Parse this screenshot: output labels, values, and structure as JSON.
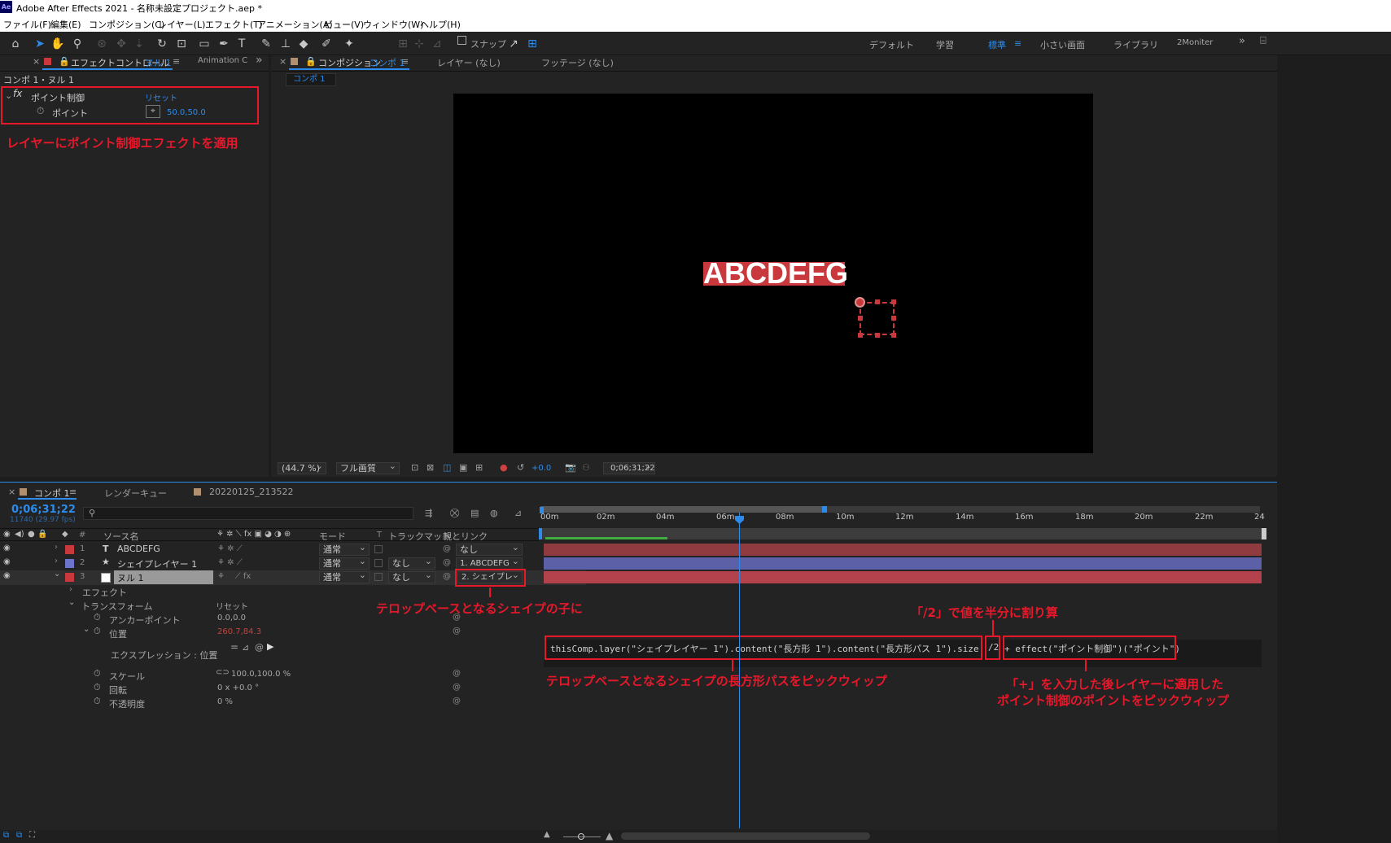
{
  "window": {
    "title": "Adobe After Effects 2021 - 名称未設定プロジェクト.aep *",
    "logo": "Ae"
  },
  "menu": [
    "ファイル(F)",
    "編集(E)",
    "コンポジション(C)",
    "レイヤー(L)",
    "エフェクト(T)",
    "アニメーション(A)",
    "ビュー(V)",
    "ウィンドウ(W)",
    "ヘルプ(H)"
  ],
  "toolbar": {
    "snap_label": "スナップ",
    "workspaces": [
      "デフォルト",
      "学習",
      "標準",
      "小さい画面",
      "ライブラリ",
      "2Moniter"
    ],
    "active_workspace": "標準"
  },
  "effect_panel": {
    "tab_label": "エフェクトコントロール",
    "tab_layer": "ヌル 1",
    "tab2": "Animation C",
    "breadcrumb": "コンポ 1・ヌル 1",
    "effect_name": "ポイント制御",
    "reset": "リセット",
    "param_name": "ポイント",
    "param_value": "50.0,50.0",
    "annotation": "レイヤーにポイント制御エフェクトを適用"
  },
  "comp_panel": {
    "tab_label": "コンポジション",
    "tab_comp": "コンポ 1",
    "layer_tab": "レイヤー (なし)",
    "footage_tab": "フッテージ (なし)",
    "comp_chip": "コンポ 1",
    "viewer_text": "ABCDEFG",
    "zoom": "(44.7 %)",
    "quality": "フル画質",
    "exposure": "+0.0",
    "timecode": "0;06;31;22"
  },
  "timeline": {
    "tabs": [
      "コンポ 1",
      "レンダーキュー",
      "20220125_213522"
    ],
    "timecode": "0;06;31;22",
    "fps": "11740 (29.97 fps)",
    "headers": {
      "num": "#",
      "source": "ソース名",
      "mode": "モード",
      "t": "T",
      "trackmatte": "トラックマット",
      "parent": "親とリンク"
    },
    "ruler": [
      "00m",
      "02m",
      "04m",
      "06m",
      "08m",
      "10m",
      "12m",
      "14m",
      "16m",
      "18m",
      "20m",
      "22m",
      "24"
    ],
    "layers": [
      {
        "num": "1",
        "type": "T",
        "name": "ABCDEFG",
        "color": "#c8383c",
        "mode": "通常",
        "matte": "",
        "parent": "なし",
        "bar": "#8f3b40"
      },
      {
        "num": "2",
        "type": "★",
        "name": "シェイプレイヤー 1",
        "color": "#6c74cc",
        "mode": "通常",
        "matte": "なし",
        "parent": "1. ABCDEFG",
        "bar": "#5c60a6"
      },
      {
        "num": "3",
        "type": "",
        "name": "ヌル 1",
        "color": "#c8383c",
        "mode": "通常",
        "matte": "なし",
        "parent": "2. シェイプレ",
        "bar": "#b4424c"
      }
    ],
    "props": {
      "effects": "エフェクト",
      "transform": "トランスフォーム",
      "transform_reset": "リセット",
      "anchor": "アンカーポイント",
      "anchor_val": "0.0,0.0",
      "position": "位置",
      "position_val": "260.7,84.3",
      "expr_label": "エクスプレッション : 位置",
      "scale": "スケール",
      "scale_val": "100.0,100.0 %",
      "rotation": "回転",
      "rotation_val": "0 x +0.0 °",
      "opacity": "不透明度",
      "opacity_val": "0 %"
    },
    "expression": {
      "part1": "thisComp.layer(\"シェイプレイヤー 1\").content(\"長方形 1\").content(\"長方形パス 1\").size",
      "part2": "/2",
      "part3": "+ effect(\"ポイント制御\")(\"ポイント\")"
    },
    "annotations": {
      "parent": "テロップベースとなるシェイプの子に",
      "half": "「/2」で値を半分に割り算",
      "pickwhip_rect": "テロップベースとなるシェイプの長方形パスをピックウィップ",
      "pickwhip_point_1": "「+」を入力した後レイヤーに適用した",
      "pickwhip_point_2": "ポイント制御のポイントをピックウィップ"
    }
  },
  "colors": {
    "accent": "#2d8ceb",
    "annotation": "#e8182b",
    "text_bg": "#c8383c"
  }
}
